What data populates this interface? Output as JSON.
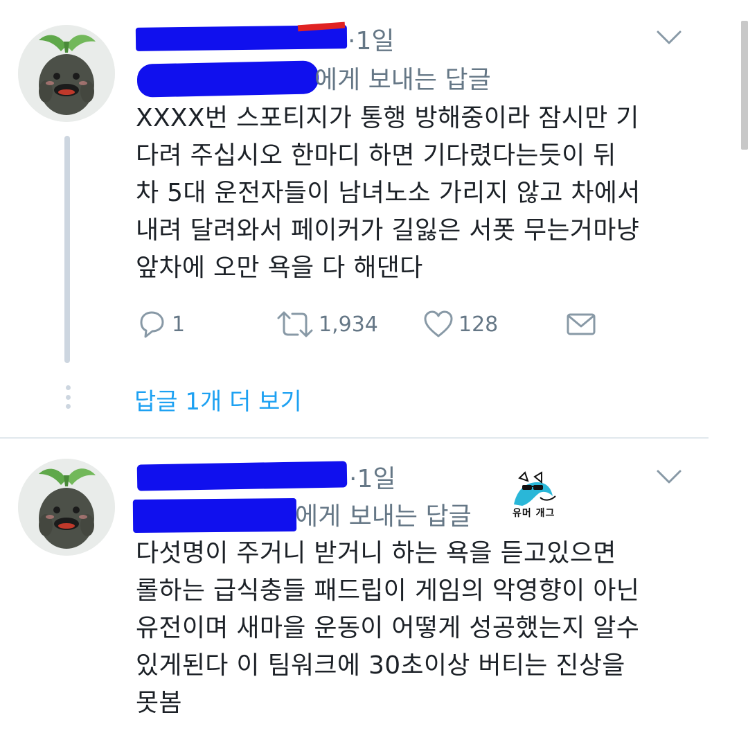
{
  "tweets": [
    {
      "timestamp": "·1일",
      "reply_to": "에게 보내는 답글",
      "text": "XXXX번 스포티지가 통행 방해중이라 잠시만 기\n다려 주십시오 한마디 하면 기다렸다는듯이 뒤\n차 5대 운전자들이 남녀노소 가리지 않고 차에서\n내려 달려와서 페이커가 길잃은 서폿 무는거마냥\n앞차에 오만 욕을 다 해댄다",
      "actions": {
        "reply_count": "1",
        "retweet_count": "1,934",
        "like_count": "128"
      },
      "show_more": "답글 1개 더 보기"
    },
    {
      "timestamp": "·1일",
      "reply_to": "에게 보내는 답글",
      "text": "다섯명이 주거니 받거니 하는 욕을 듣고있으면\n롤하는 급식충들 패드립이 게임의 악영향이 아닌\n유전이며 새마을 운동이 어떻게 성공했는지 알수\n있게된다 이 팀워크에 30초이상 버티는 진상을\n못봄"
    }
  ],
  "watermark": {
    "text": "유머 개그"
  },
  "colors": {
    "accent": "#1da1f2",
    "secondary_text": "#657786",
    "redaction": "#1010ee"
  },
  "icons": {
    "reply": "reply-icon",
    "retweet": "retweet-icon",
    "like": "heart-icon",
    "dm": "envelope-icon",
    "menu": "chevron-down-icon"
  }
}
